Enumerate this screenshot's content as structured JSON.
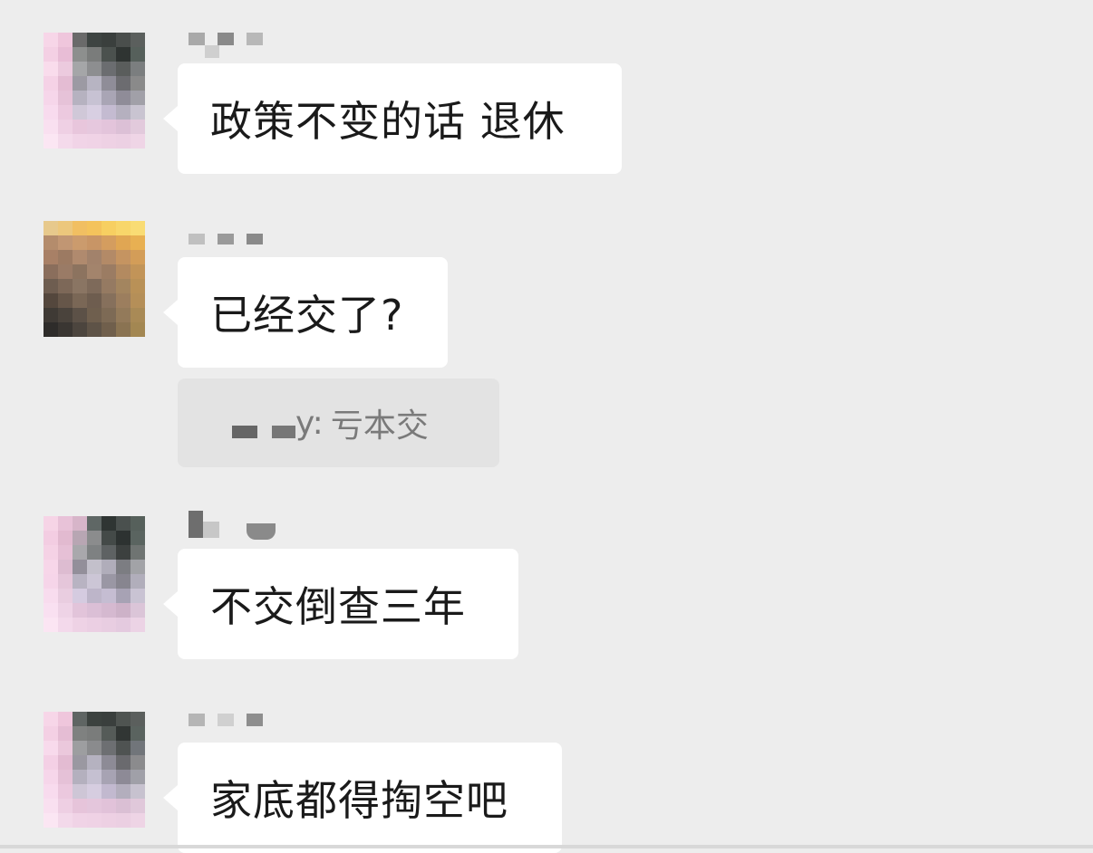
{
  "messages": [
    {
      "sender": "",
      "text": "政策不变的话 退休"
    },
    {
      "sender": "",
      "text": "已经交了?"
    },
    {
      "sender": "",
      "text": "不交倒查三年"
    },
    {
      "sender": "",
      "text": "家底都得掏空吧"
    }
  ],
  "quote": {
    "name_suffix": "y:",
    "text": "亏本交"
  },
  "colors": {
    "background": "#ededed",
    "bubble": "#ffffff",
    "quote_background": "#e3e3e3",
    "text": "#1a1a1a",
    "quote_text": "#7a7a7a"
  }
}
